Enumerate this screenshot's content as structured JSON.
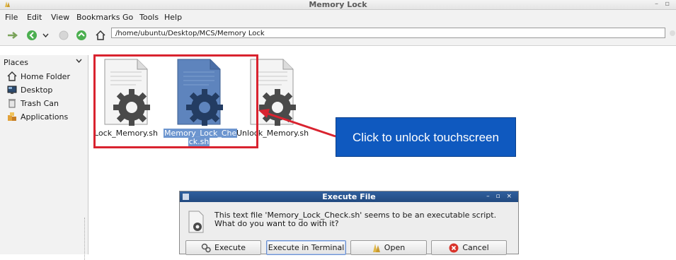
{
  "window": {
    "title": "Memory Lock",
    "controls": "– ▫"
  },
  "menu": {
    "items": [
      {
        "label": "File"
      },
      {
        "label": "Edit"
      },
      {
        "label": "View"
      },
      {
        "label": "Bookmarks"
      },
      {
        "label": "Go"
      },
      {
        "label": "Tools"
      },
      {
        "label": "Help"
      }
    ]
  },
  "toolbar": {
    "location_value": "/home/ubuntu/Desktop/MCS/Memory Lock"
  },
  "sidebar": {
    "header": "Places",
    "items": [
      {
        "label": "Home Folder",
        "icon": "home-icon"
      },
      {
        "label": "Desktop",
        "icon": "desktop-icon"
      },
      {
        "label": "Trash Can",
        "icon": "trash-icon"
      },
      {
        "label": "Applications",
        "icon": "applications-icon"
      }
    ]
  },
  "files": [
    {
      "name": "Lock_Memory.sh",
      "selected": false
    },
    {
      "name_line1": "Memory_Lock_Che",
      "name_line2": "ck.sh",
      "selected": true
    },
    {
      "name": "Unlock_Memory.sh",
      "selected": false
    }
  ],
  "annotation": {
    "callout_text": "Click to unlock touchscreen",
    "box_color": "#d9232f",
    "callout_color": "#0f59bf"
  },
  "dialog": {
    "title": "Execute File",
    "controls": "– ▫ ×",
    "message_line1": "This text file 'Memory_Lock_Check.sh' seems to be an executable script.",
    "message_line2": "What do you want to do with it?",
    "buttons": {
      "execute": "Execute",
      "execute_terminal": "Execute in Terminal",
      "open": "Open",
      "cancel": "Cancel"
    }
  },
  "colors": {
    "selection": "#6c95cf",
    "dialog_title": "#2f5f9e"
  }
}
